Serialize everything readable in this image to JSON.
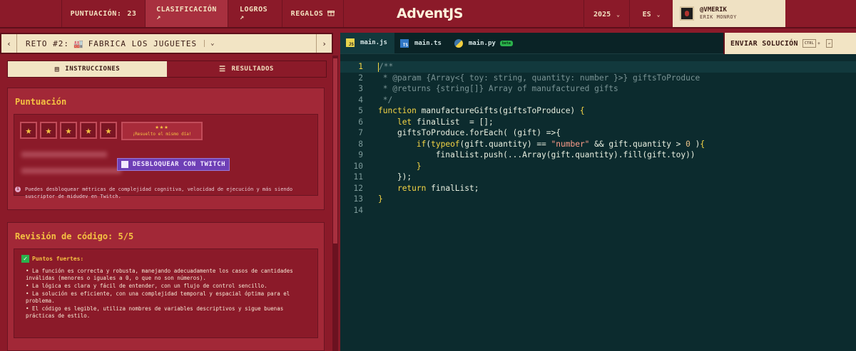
{
  "nav": {
    "score_label": "PUNTUACIÓN:",
    "score_value": "23",
    "leaderboard": "CLASIFICACIÓN ↗",
    "achievements": "LOGROS ↗",
    "gifts": "REGALOS",
    "gifts_icon": "gift-icon",
    "brand": "AdventJS",
    "year": "2025",
    "lang": "ES",
    "user_handle": "@VMERIK",
    "user_name": "ERIK MONROY"
  },
  "challenge": {
    "title": "RETO #2:",
    "emoji": "🏭",
    "name": "FABRICA LOS JUGUETES"
  },
  "tabs": {
    "instructions": "INSTRUCCIONES",
    "results": "RESULTADOS"
  },
  "score_card": {
    "title": "Puntuación",
    "stars": 5,
    "badge_stars": "★★★",
    "badge_text": "¡Resuelto el mismo día!",
    "twitch_button": "DESBLOQUEAR CON TWITCH",
    "info": "Puedes desbloquear métricas de complejidad cognitiva, velocidad de ejecución y más siendo suscriptor de midudev en Twitch."
  },
  "review_card": {
    "title": "Revisión de código: 5/5",
    "strengths_label": "Puntos fuertes:",
    "bullets": [
      "• La función es correcta y robusta, manejando adecuadamente los casos de cantidades inválidas (menores o iguales a 0, o que no son números).",
      "• La lógica es clara y fácil de entender, con un flujo de control sencillo.",
      "• La solución es eficiente, con una complejidad temporal y espacial óptima para el problema.",
      "• El código es legible, utiliza nombres de variables descriptivos y sigue buenas prácticas de estilo."
    ]
  },
  "editor": {
    "files": [
      "main.js",
      "main.ts",
      "main.py"
    ],
    "beta": "beta",
    "submit": "ENVIAR SOLUCIÓN",
    "kbd1": "CTRL",
    "kbd2": "↵",
    "line_numbers": [
      "1",
      "2",
      "3",
      "4",
      "5",
      "6",
      "7",
      "8",
      "9",
      "10",
      "11",
      "12",
      "13",
      "14"
    ]
  },
  "colors": {
    "bg_red": "#8b1a29",
    "cream": "#f2e4c4",
    "gold": "#f5c242",
    "editor_bg": "#0c2b2e",
    "twitch": "#6e3fb6"
  }
}
